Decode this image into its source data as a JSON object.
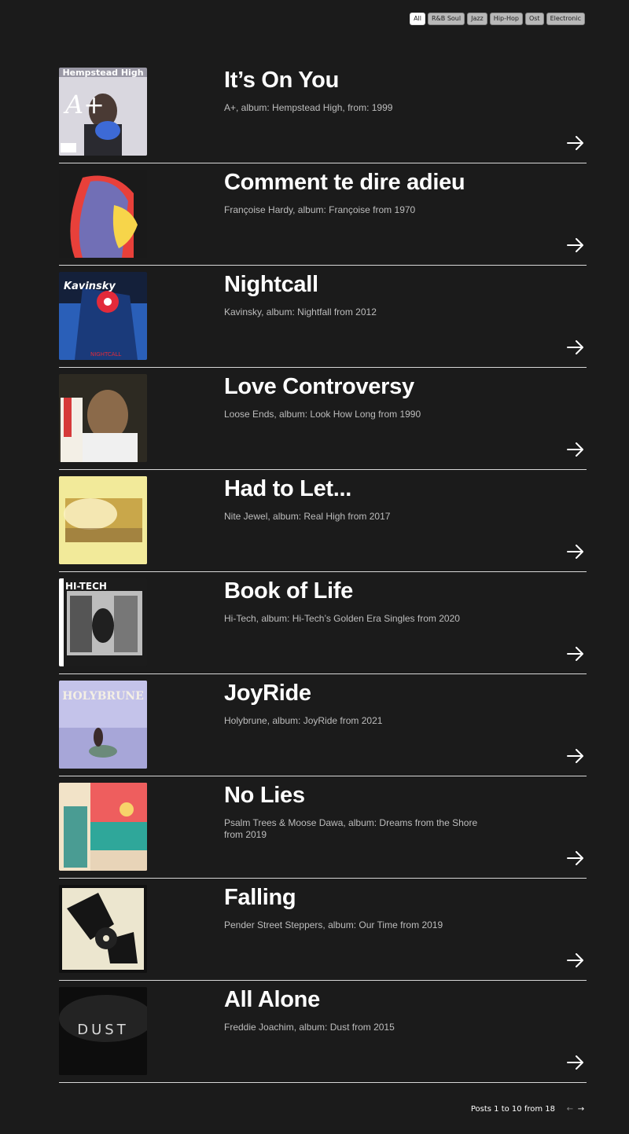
{
  "filters": [
    "All",
    "R&B Soul",
    "Jazz",
    "Hip-Hop",
    "Ost",
    "Electronic"
  ],
  "active_filter": "All",
  "posts": [
    {
      "title": "It’s On You",
      "meta": "A+, album: Hempstead High, from: 1999",
      "cover_text": "Hempstead High",
      "cover_text2": "A+",
      "cover_colors": [
        "#9a98a5",
        "#d9d7df"
      ]
    },
    {
      "title": "Comment te dire adieu",
      "meta": "Françoise Hardy, album: Françoise from 1970",
      "cover_colors": [
        "#1a1a1a",
        "#e8403a"
      ]
    },
    {
      "title": "Nightcall",
      "meta": "Kavinsky, album: Nightfall from 2012",
      "cover_text": "Kavinsky",
      "cover_text2": "NIGHTCALL",
      "cover_colors": [
        "#14203a",
        "#2a5fb8"
      ]
    },
    {
      "title": "Love Controversy",
      "meta": "Loose Ends, album: Look How Long from 1990",
      "cover_colors": [
        "#2d2a22",
        "#8b6a4a"
      ]
    },
    {
      "title": "Had to Let...",
      "meta": "Nite Jewel, album: Real High from 2017",
      "cover_colors": [
        "#f2ea9a",
        "#f6e8a8"
      ]
    },
    {
      "title": "Book of Life",
      "meta": "Hi-Tech, album: Hi-Tech’s Golden Era Singles from 2020",
      "cover_text": "HI-TECH",
      "cover_colors": [
        "#1c1c1c",
        "#bdbdbd"
      ]
    },
    {
      "title": "JoyRide",
      "meta": "Holybrune, album: JoyRide from 2021",
      "cover_text": "HOLYBRUNE",
      "cover_colors": [
        "#a7a6d8",
        "#c4c3ea"
      ]
    },
    {
      "title": "No Lies",
      "meta": "Psalm Trees & Moose Dawa, album: Dreams from the Shore from 2019",
      "cover_colors": [
        "#ee5e5e",
        "#2fa79a"
      ]
    },
    {
      "title": "Falling",
      "meta": "Pender Street Steppers, album: Our Time from 2019",
      "cover_colors": [
        "#111111",
        "#ece6cf"
      ]
    },
    {
      "title": "All Alone",
      "meta": "Freddie Joachim, album: Dust from 2015",
      "cover_text": "DUST",
      "cover_colors": [
        "#0d0d0d",
        "#3a3a3a"
      ]
    }
  ],
  "pagination": {
    "label": "Posts 1 to 10 from 18",
    "prev": "←",
    "next": "→"
  }
}
